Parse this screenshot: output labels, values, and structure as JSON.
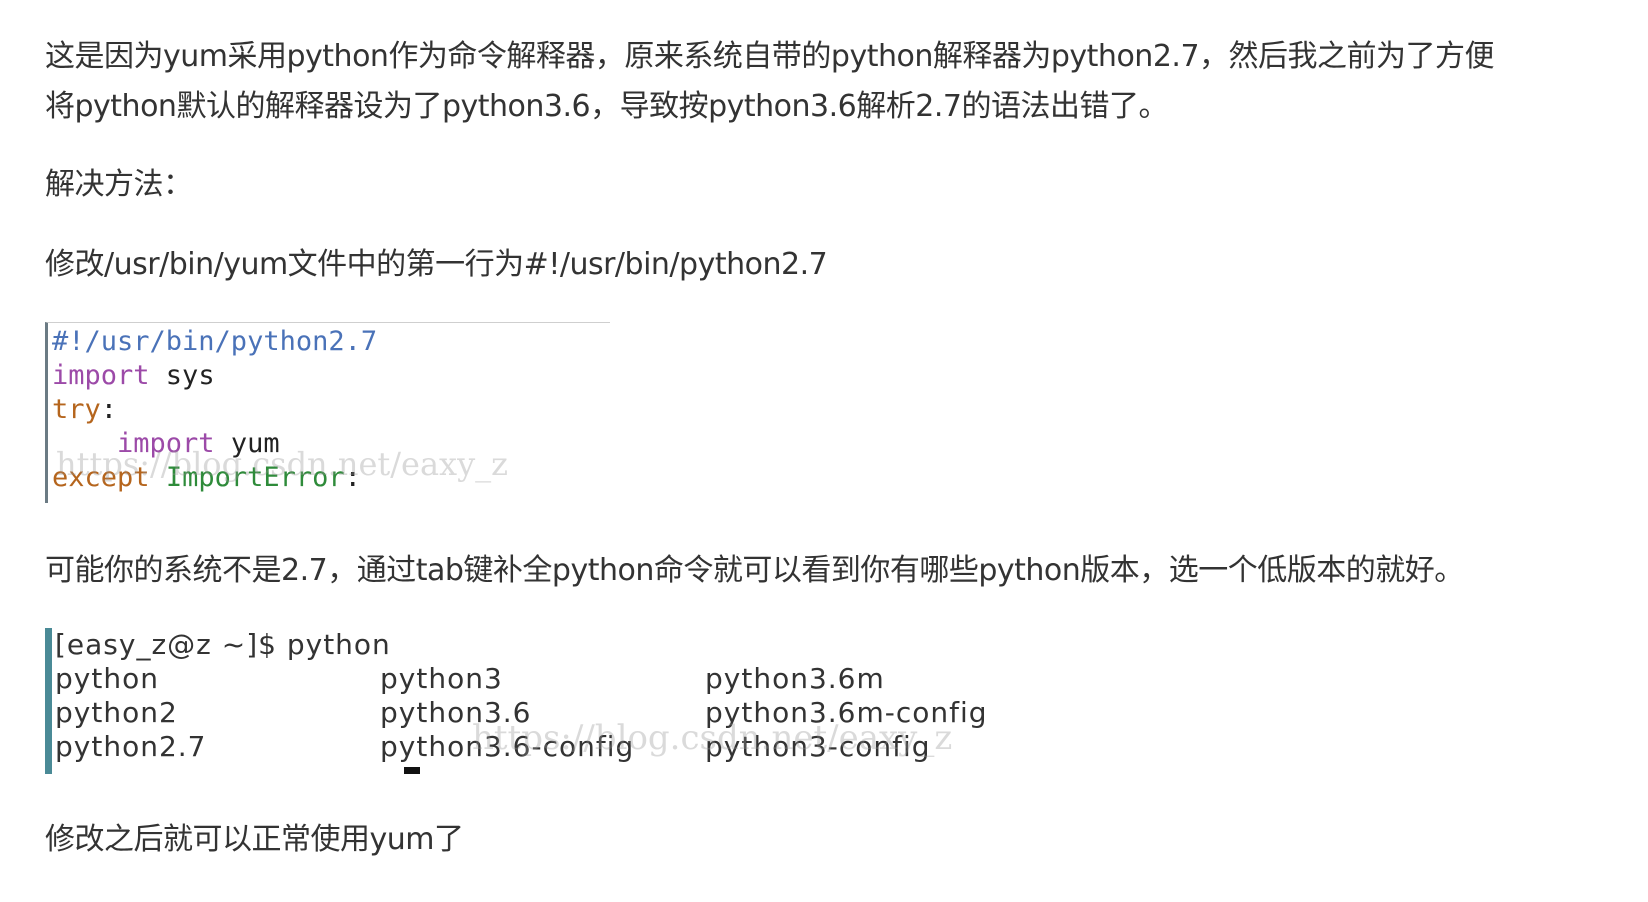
{
  "article": {
    "para1": "这是因为yum采用python作为命令解释器，原来系统自带的python解释器为python2.7，然后我之前为了方便将python默认的解释器设为了python3.6，导致按python3.6解析2.7的语法出错了。",
    "para2": "解决方法：",
    "para3": "修改/usr/bin/yum文件中的第一行为#!/usr/bin/python2.7",
    "para4": "可能你的系统不是2.7，通过tab键补全python命令就可以看到你有哪些python版本，选一个低版本的就好。",
    "para5": "修改之后就可以正常使用yum了"
  },
  "code_image": {
    "line1": "#!/usr/bin/python2.7",
    "line2_kw": "import",
    "line2_rest": " sys",
    "line3_kw": "try",
    "line3_rest": ":",
    "line4_indent": "    ",
    "line4_kw": "import",
    "line4_rest": " yum",
    "line5_kw": "except",
    "line5_cls": "ImportError",
    "line5_rest": ":",
    "watermark": "https://blog.csdn.net/eaxy_z"
  },
  "terminal_image": {
    "prompt": "[easy_z@z ~]$ python",
    "col1": [
      "python",
      "python2",
      "python2.7"
    ],
    "col2": [
      "python3",
      "python3.6",
      "python3.6-config"
    ],
    "col3": [
      "python3.6m",
      "python3.6m-config",
      "python3-config"
    ],
    "watermark": "https://blog.csdn.net/eaxy_z"
  },
  "colors": {
    "text": "#333333",
    "code_shebang": "#4a72b8",
    "code_keyword": "#9c4aa8",
    "code_class": "#2e8b3a",
    "terminal_border": "#4a8a96"
  }
}
